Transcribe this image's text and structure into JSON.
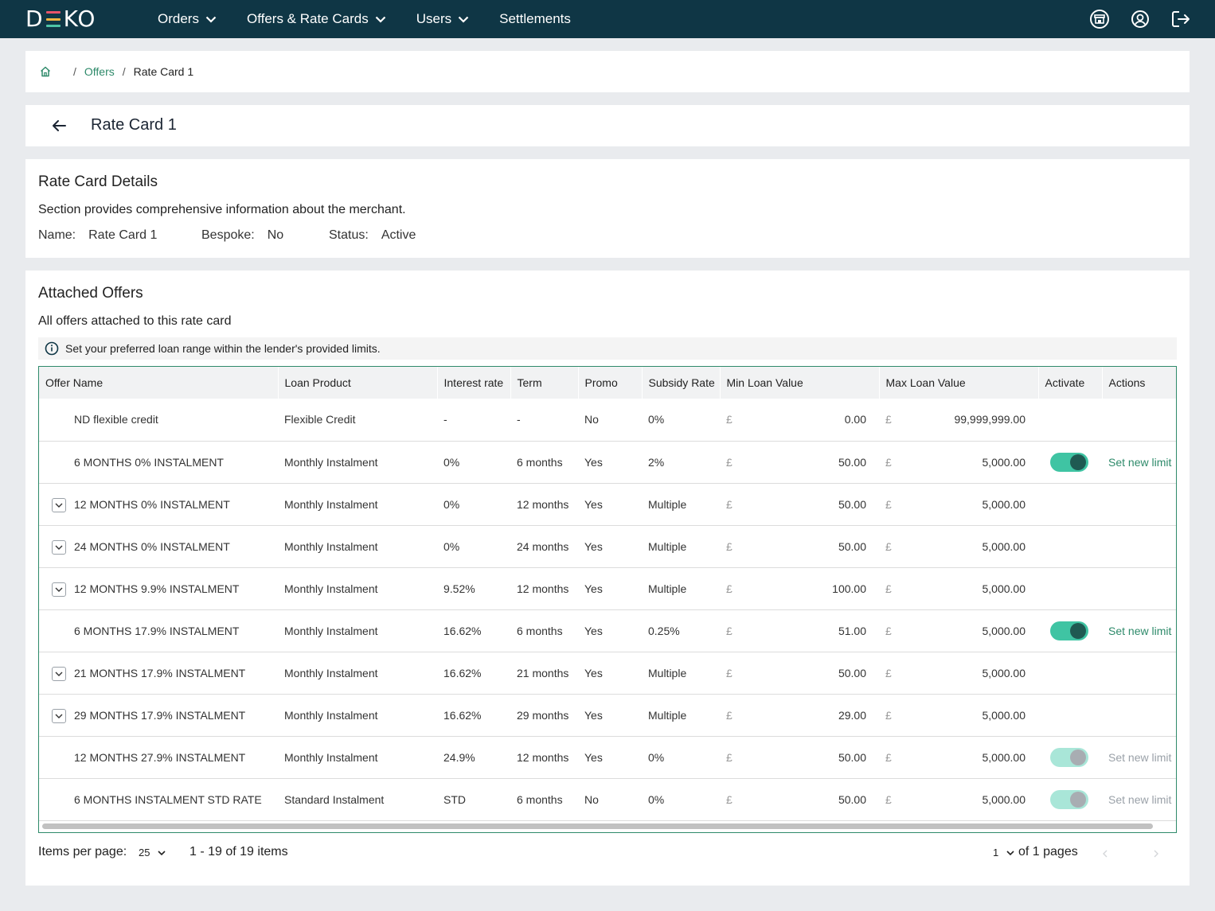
{
  "nav": {
    "logo": {
      "d": "D",
      "ko": "KO"
    },
    "logo_colors": [
      "#e8546a",
      "#f2b541",
      "#4ec5a7"
    ],
    "items": [
      {
        "label": "Orders",
        "dropdown": true
      },
      {
        "label": "Offers & Rate Cards",
        "dropdown": true
      },
      {
        "label": "Users",
        "dropdown": true
      },
      {
        "label": "Settlements",
        "dropdown": false
      }
    ],
    "right_icons": [
      "store-icon",
      "account-circle-icon",
      "logout-icon"
    ]
  },
  "breadcrumb": {
    "link": "Offers",
    "current": "Rate Card 1"
  },
  "page": {
    "title": "Rate Card 1"
  },
  "details": {
    "title": "Rate Card Details",
    "subtitle": "Section provides comprehensive information about the merchant.",
    "name_label": "Name:",
    "name_value": "Rate Card 1",
    "bespoke_label": "Bespoke:",
    "bespoke_value": "No",
    "status_label": "Status:",
    "status_value": "Active"
  },
  "offers": {
    "title": "Attached Offers",
    "subtitle": "All offers attached to this rate card",
    "info": "Set your preferred loan range within the lender's provided limits.",
    "columns": [
      "Offer Name",
      "Loan Product",
      "Interest rate",
      "Term",
      "Promo",
      "Subsidy Rate",
      "Min Loan Value",
      "Max Loan Value",
      "Activate",
      "Actions"
    ],
    "currency": "£",
    "rows": [
      {
        "name": "ND flexible credit",
        "product": "Flexible Credit",
        "rate": "-",
        "term": "-",
        "promo": "No",
        "subsidy": "0%",
        "min": "0.00",
        "max": "99,999,999.00",
        "expandable": false,
        "toggle": "none",
        "action": ""
      },
      {
        "name": "6 MONTHS 0% INSTALMENT",
        "product": "Monthly Instalment",
        "rate": "0%",
        "term": "6 months",
        "promo": "Yes",
        "subsidy": "2%",
        "min": "50.00",
        "max": "5,000.00",
        "expandable": false,
        "toggle": "on",
        "action": "Set new limit"
      },
      {
        "name": "12 MONTHS 0% INSTALMENT",
        "product": "Monthly Instalment",
        "rate": "0%",
        "term": "12 months",
        "promo": "Yes",
        "subsidy": "Multiple",
        "min": "50.00",
        "max": "5,000.00",
        "expandable": true,
        "toggle": "none",
        "action": ""
      },
      {
        "name": "24 MONTHS 0% INSTALMENT",
        "product": "Monthly Instalment",
        "rate": "0%",
        "term": "24 months",
        "promo": "Yes",
        "subsidy": "Multiple",
        "min": "50.00",
        "max": "5,000.00",
        "expandable": true,
        "toggle": "none",
        "action": ""
      },
      {
        "name": "12 MONTHS 9.9% INSTALMENT",
        "product": "Monthly Instalment",
        "rate": "9.52%",
        "term": "12 months",
        "promo": "Yes",
        "subsidy": "Multiple",
        "min": "100.00",
        "max": "5,000.00",
        "expandable": true,
        "toggle": "none",
        "action": ""
      },
      {
        "name": "6 MONTHS 17.9% INSTALMENT",
        "product": "Monthly Instalment",
        "rate": "16.62%",
        "term": "6 months",
        "promo": "Yes",
        "subsidy": "0.25%",
        "min": "51.00",
        "max": "5,000.00",
        "expandable": false,
        "toggle": "on",
        "action": "Set new limit"
      },
      {
        "name": "21 MONTHS 17.9% INSTALMENT",
        "product": "Monthly Instalment",
        "rate": "16.62%",
        "term": "21 months",
        "promo": "Yes",
        "subsidy": "Multiple",
        "min": "50.00",
        "max": "5,000.00",
        "expandable": true,
        "toggle": "none",
        "action": ""
      },
      {
        "name": "29 MONTHS 17.9% INSTALMENT",
        "product": "Monthly Instalment",
        "rate": "16.62%",
        "term": "29 months",
        "promo": "Yes",
        "subsidy": "Multiple",
        "min": "29.00",
        "max": "5,000.00",
        "expandable": true,
        "toggle": "none",
        "action": ""
      },
      {
        "name": "12 MONTHS 27.9% INSTALMENT",
        "product": "Monthly Instalment",
        "rate": "24.9%",
        "term": "12 months",
        "promo": "Yes",
        "subsidy": "0%",
        "min": "50.00",
        "max": "5,000.00",
        "expandable": false,
        "toggle": "disabled",
        "action": "Set new limit"
      },
      {
        "name": "6 MONTHS INSTALMENT STD RATE",
        "product": "Standard Instalment",
        "rate": "STD",
        "term": "6 months",
        "promo": "No",
        "subsidy": "0%",
        "min": "50.00",
        "max": "5,000.00",
        "expandable": false,
        "toggle": "disabled",
        "action": "Set new limit"
      }
    ]
  },
  "pagination": {
    "items_per_page_label": "Items per page:",
    "items_per_page": "25",
    "range": "1 - 19 of 19 items",
    "page": "1",
    "pages_label": "of 1 pages"
  }
}
